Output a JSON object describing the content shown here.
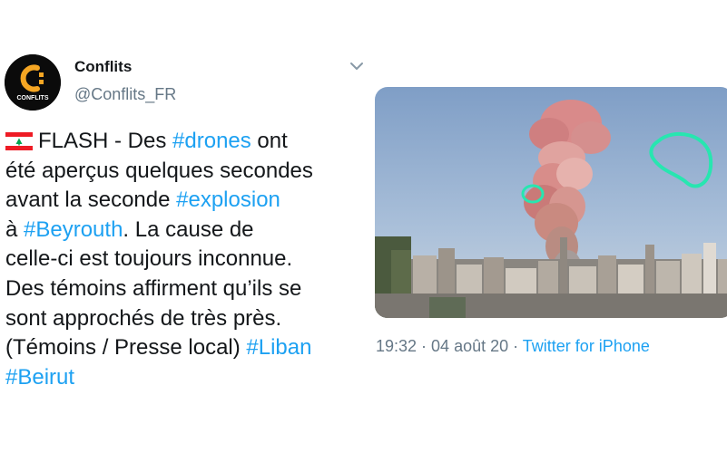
{
  "author": {
    "name": "Conflits",
    "handle": "@Conflits_FR",
    "avatar_text": "CONFLITS",
    "avatar_icon": "logo-icon"
  },
  "tweet": {
    "flag_icon": "lebanon-flag-icon",
    "lines": [
      [
        {
          "t": "FLASH - Des "
        },
        {
          "t": "#drones",
          "h": true
        },
        {
          "t": " ont"
        }
      ],
      [
        {
          "t": "été aperçus quelques secondes"
        }
      ],
      [
        {
          "t": "avant la seconde "
        },
        {
          "t": "#explosion",
          "h": true
        }
      ],
      [
        {
          "t": "à "
        },
        {
          "t": "#Beyrouth",
          "h": true
        },
        {
          "t": ". La cause de"
        }
      ],
      [
        {
          "t": "celle-ci est toujours inconnue."
        }
      ],
      [
        {
          "t": "Des témoins affirment qu’ils se"
        }
      ],
      [
        {
          "t": "sont approchés de très près."
        }
      ],
      [
        {
          "t": "(Témoins / Presse local) "
        },
        {
          "t": "#Liban",
          "h": true
        }
      ],
      [
        {
          "t": "#Beirut",
          "h": true
        }
      ]
    ]
  },
  "media": {
    "alt_icon": "explosion-photo-image"
  },
  "meta": {
    "time": "19:32 · 04 août 20 · ",
    "source": "Twitter for iPhone"
  },
  "colors": {
    "link": "#1da1f2",
    "secondary": "#657786",
    "text": "#14171a"
  }
}
